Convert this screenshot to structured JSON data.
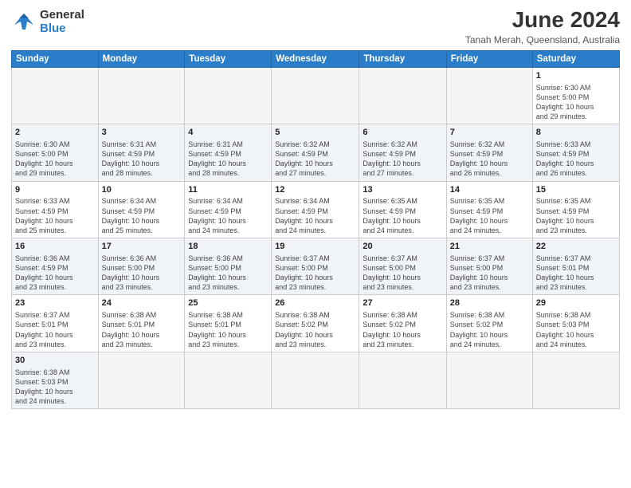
{
  "logo": {
    "line1": "General",
    "line2": "Blue"
  },
  "title": "June 2024",
  "location": "Tanah Merah, Queensland, Australia",
  "weekdays": [
    "Sunday",
    "Monday",
    "Tuesday",
    "Wednesday",
    "Thursday",
    "Friday",
    "Saturday"
  ],
  "weeks": [
    [
      {
        "day": "",
        "info": ""
      },
      {
        "day": "",
        "info": ""
      },
      {
        "day": "",
        "info": ""
      },
      {
        "day": "",
        "info": ""
      },
      {
        "day": "",
        "info": ""
      },
      {
        "day": "",
        "info": ""
      },
      {
        "day": "1",
        "info": "Sunrise: 6:30 AM\nSunset: 5:00 PM\nDaylight: 10 hours\nand 29 minutes."
      }
    ],
    [
      {
        "day": "2",
        "info": "Sunrise: 6:30 AM\nSunset: 5:00 PM\nDaylight: 10 hours\nand 29 minutes."
      },
      {
        "day": "3",
        "info": "Sunrise: 6:31 AM\nSunset: 4:59 PM\nDaylight: 10 hours\nand 28 minutes."
      },
      {
        "day": "4",
        "info": "Sunrise: 6:31 AM\nSunset: 4:59 PM\nDaylight: 10 hours\nand 28 minutes."
      },
      {
        "day": "5",
        "info": "Sunrise: 6:32 AM\nSunset: 4:59 PM\nDaylight: 10 hours\nand 27 minutes."
      },
      {
        "day": "6",
        "info": "Sunrise: 6:32 AM\nSunset: 4:59 PM\nDaylight: 10 hours\nand 27 minutes."
      },
      {
        "day": "7",
        "info": "Sunrise: 6:32 AM\nSunset: 4:59 PM\nDaylight: 10 hours\nand 26 minutes."
      },
      {
        "day": "8",
        "info": "Sunrise: 6:33 AM\nSunset: 4:59 PM\nDaylight: 10 hours\nand 26 minutes."
      }
    ],
    [
      {
        "day": "9",
        "info": "Sunrise: 6:33 AM\nSunset: 4:59 PM\nDaylight: 10 hours\nand 25 minutes."
      },
      {
        "day": "10",
        "info": "Sunrise: 6:34 AM\nSunset: 4:59 PM\nDaylight: 10 hours\nand 25 minutes."
      },
      {
        "day": "11",
        "info": "Sunrise: 6:34 AM\nSunset: 4:59 PM\nDaylight: 10 hours\nand 24 minutes."
      },
      {
        "day": "12",
        "info": "Sunrise: 6:34 AM\nSunset: 4:59 PM\nDaylight: 10 hours\nand 24 minutes."
      },
      {
        "day": "13",
        "info": "Sunrise: 6:35 AM\nSunset: 4:59 PM\nDaylight: 10 hours\nand 24 minutes."
      },
      {
        "day": "14",
        "info": "Sunrise: 6:35 AM\nSunset: 4:59 PM\nDaylight: 10 hours\nand 24 minutes."
      },
      {
        "day": "15",
        "info": "Sunrise: 6:35 AM\nSunset: 4:59 PM\nDaylight: 10 hours\nand 23 minutes."
      }
    ],
    [
      {
        "day": "16",
        "info": "Sunrise: 6:36 AM\nSunset: 4:59 PM\nDaylight: 10 hours\nand 23 minutes."
      },
      {
        "day": "17",
        "info": "Sunrise: 6:36 AM\nSunset: 5:00 PM\nDaylight: 10 hours\nand 23 minutes."
      },
      {
        "day": "18",
        "info": "Sunrise: 6:36 AM\nSunset: 5:00 PM\nDaylight: 10 hours\nand 23 minutes."
      },
      {
        "day": "19",
        "info": "Sunrise: 6:37 AM\nSunset: 5:00 PM\nDaylight: 10 hours\nand 23 minutes."
      },
      {
        "day": "20",
        "info": "Sunrise: 6:37 AM\nSunset: 5:00 PM\nDaylight: 10 hours\nand 23 minutes."
      },
      {
        "day": "21",
        "info": "Sunrise: 6:37 AM\nSunset: 5:00 PM\nDaylight: 10 hours\nand 23 minutes."
      },
      {
        "day": "22",
        "info": "Sunrise: 6:37 AM\nSunset: 5:01 PM\nDaylight: 10 hours\nand 23 minutes."
      }
    ],
    [
      {
        "day": "23",
        "info": "Sunrise: 6:37 AM\nSunset: 5:01 PM\nDaylight: 10 hours\nand 23 minutes."
      },
      {
        "day": "24",
        "info": "Sunrise: 6:38 AM\nSunset: 5:01 PM\nDaylight: 10 hours\nand 23 minutes."
      },
      {
        "day": "25",
        "info": "Sunrise: 6:38 AM\nSunset: 5:01 PM\nDaylight: 10 hours\nand 23 minutes."
      },
      {
        "day": "26",
        "info": "Sunrise: 6:38 AM\nSunset: 5:02 PM\nDaylight: 10 hours\nand 23 minutes."
      },
      {
        "day": "27",
        "info": "Sunrise: 6:38 AM\nSunset: 5:02 PM\nDaylight: 10 hours\nand 23 minutes."
      },
      {
        "day": "28",
        "info": "Sunrise: 6:38 AM\nSunset: 5:02 PM\nDaylight: 10 hours\nand 24 minutes."
      },
      {
        "day": "29",
        "info": "Sunrise: 6:38 AM\nSunset: 5:03 PM\nDaylight: 10 hours\nand 24 minutes."
      }
    ],
    [
      {
        "day": "30",
        "info": "Sunrise: 6:38 AM\nSunset: 5:03 PM\nDaylight: 10 hours\nand 24 minutes."
      },
      {
        "day": "",
        "info": ""
      },
      {
        "day": "",
        "info": ""
      },
      {
        "day": "",
        "info": ""
      },
      {
        "day": "",
        "info": ""
      },
      {
        "day": "",
        "info": ""
      },
      {
        "day": "",
        "info": ""
      }
    ]
  ]
}
